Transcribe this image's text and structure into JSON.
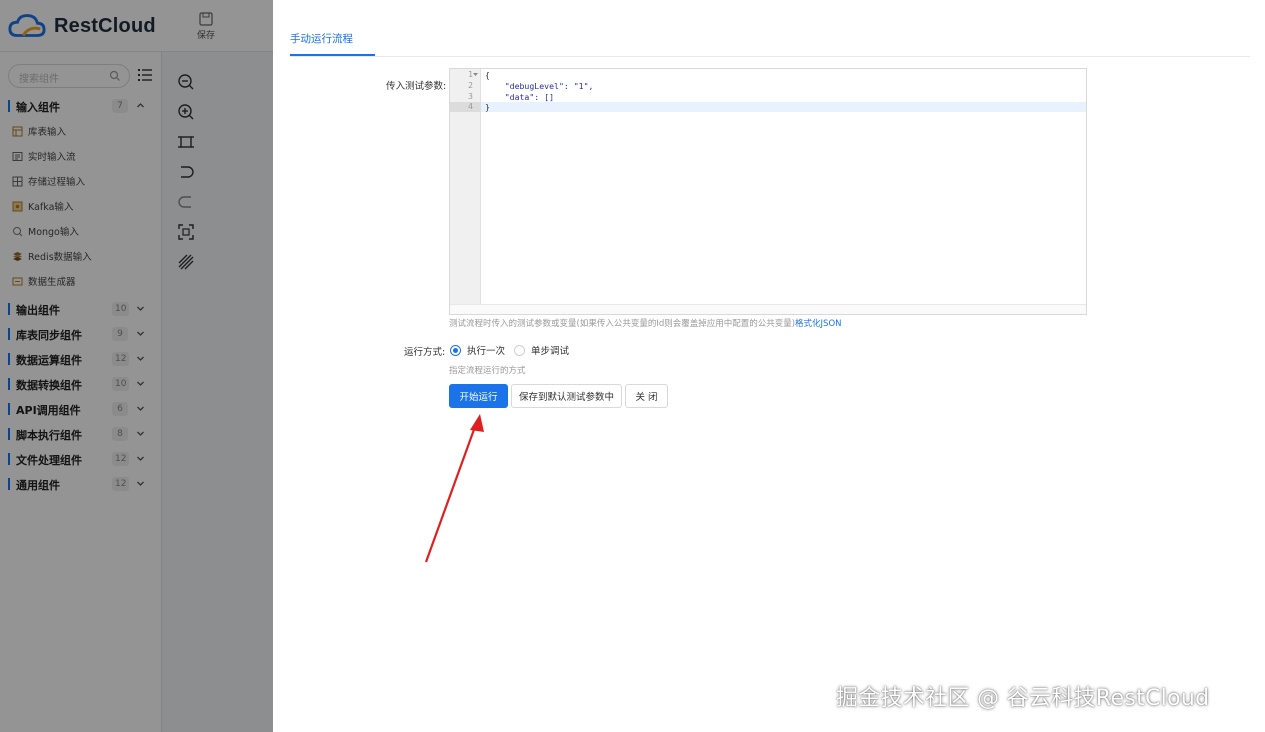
{
  "app": {
    "brand": "RestCloud",
    "save_label": "保存",
    "search_placeholder": "搜索组件"
  },
  "sidebar": {
    "groups": [
      {
        "label": "输入组件",
        "count": "7",
        "expanded": true
      },
      {
        "label": "输出组件",
        "count": "10"
      },
      {
        "label": "库表同步组件",
        "count": "9"
      },
      {
        "label": "数据运算组件",
        "count": "12"
      },
      {
        "label": "数据转换组件",
        "count": "10"
      },
      {
        "label": "API调用组件",
        "count": "6"
      },
      {
        "label": "脚本执行组件",
        "count": "8"
      },
      {
        "label": "文件处理组件",
        "count": "12"
      },
      {
        "label": "通用组件",
        "count": "12"
      }
    ],
    "input_items": [
      {
        "label": "库表输入",
        "icon": "table-icon"
      },
      {
        "label": "实时输入流",
        "icon": "stream-icon"
      },
      {
        "label": "存储过程输入",
        "icon": "procedure-icon"
      },
      {
        "label": "Kafka输入",
        "icon": "kafka-icon"
      },
      {
        "label": "Mongo输入",
        "icon": "mongo-icon"
      },
      {
        "label": "Redis数据输入",
        "icon": "redis-icon"
      },
      {
        "label": "数据生成器",
        "icon": "generator-icon"
      }
    ]
  },
  "canvas_tools": [
    "zoom-out-icon",
    "zoom-in-icon",
    "fit-icon",
    "undo-icon",
    "redo-icon",
    "fullscreen-icon",
    "grid-icon"
  ],
  "dialog": {
    "tab_label": "手动运行流程",
    "params_label": "传入测试参数:",
    "editor": {
      "line_numbers": [
        "1",
        "2",
        "3",
        "4"
      ],
      "lines": [
        "{",
        "    \"debugLevel\": \"1\",",
        "    \"data\": []",
        "}"
      ]
    },
    "params_hint": "测试流程时传入的测试参数或变量(如果传入公共变量的Id则会覆盖掉应用中配置的公共变量)",
    "format_link": "格式化JSON",
    "run_mode_label": "运行方式:",
    "run_mode_options": [
      {
        "label": "执行一次",
        "checked": true
      },
      {
        "label": "单步调试",
        "checked": false
      }
    ],
    "run_mode_hint": "指定流程运行的方式",
    "buttons": {
      "start": "开始运行",
      "save_default": "保存到默认测试参数中",
      "close": "关 闭"
    }
  },
  "watermark": "掘金技术社区 @ 谷云科技RestCloud",
  "colors": {
    "accent": "#1a73e8",
    "arrow": "#e02020"
  }
}
